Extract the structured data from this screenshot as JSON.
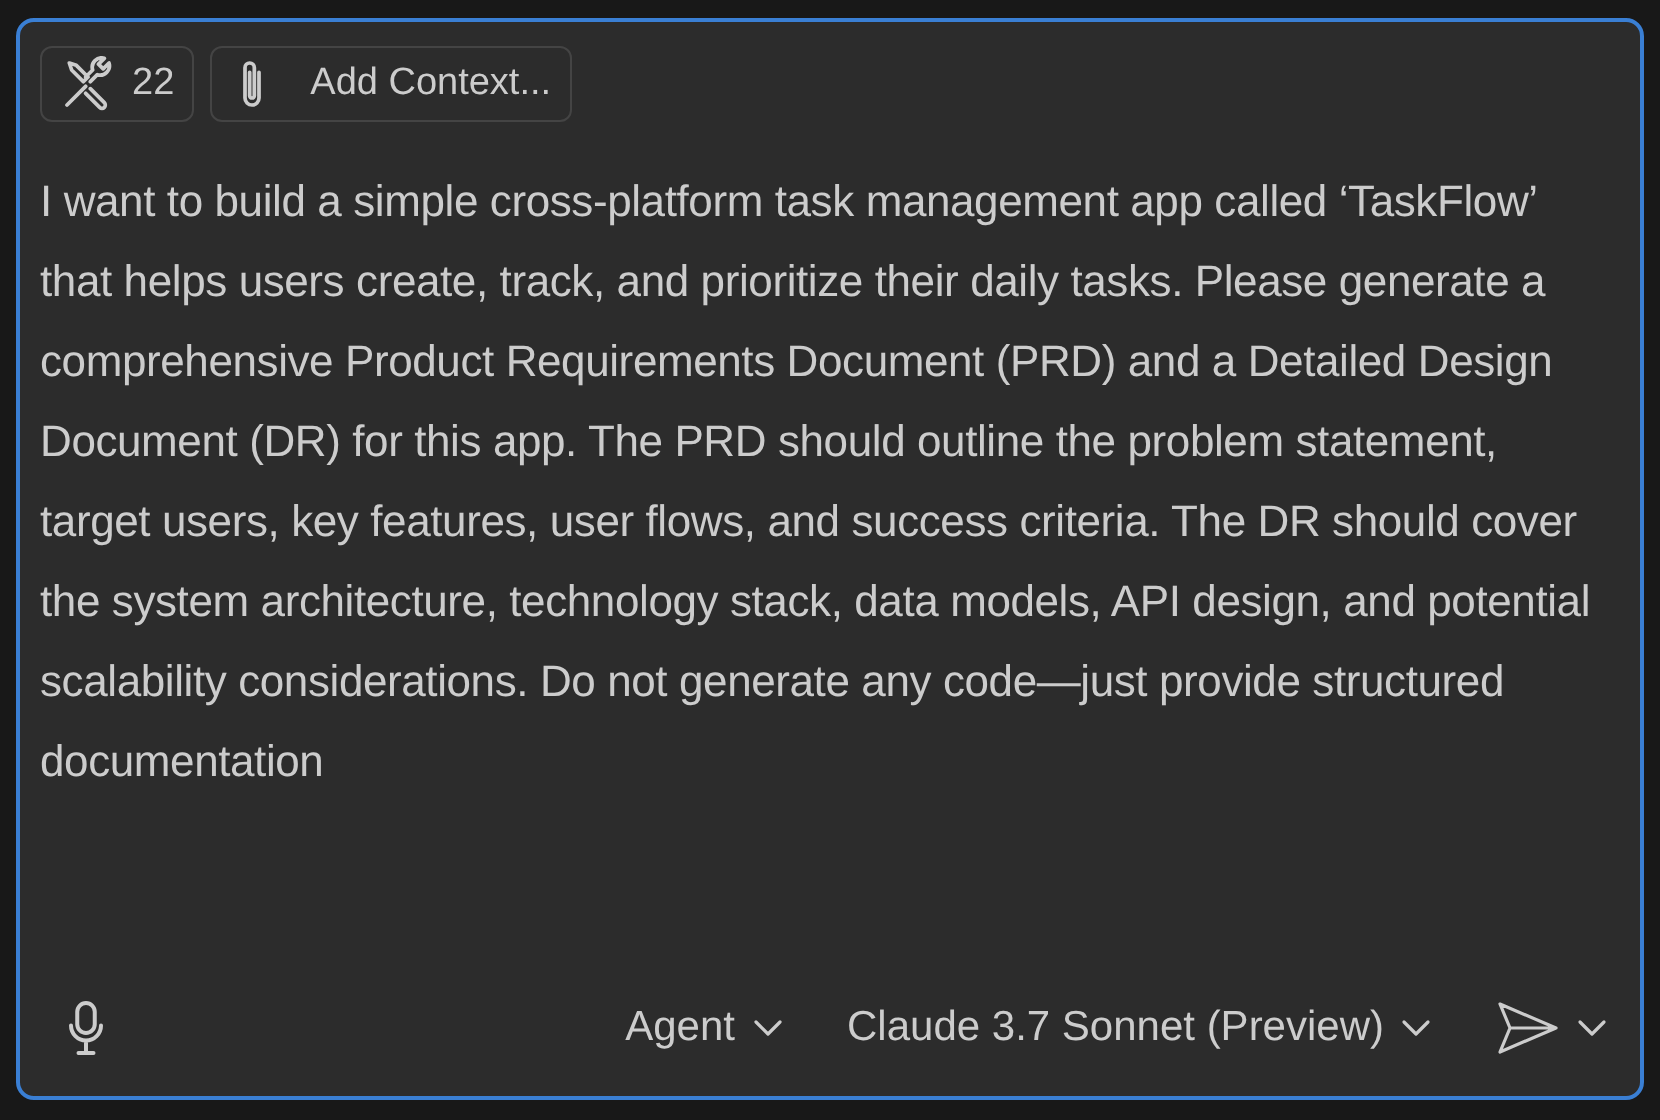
{
  "toolbar": {
    "tools_count": "22",
    "add_context": "Add Context..."
  },
  "prompt": "I want to build a simple cross-platform task management app called ‘TaskFlow’ that helps users create, track, and prioritize their daily tasks. Please generate a comprehensive Product Requirements Document (PRD) and a Detailed Design Document (DR) for this app. The PRD should outline the problem statement, target users, key features, user flows, and success criteria. The DR should cover the system architecture, technology stack, data models, API design, and potential scalability considerations. Do not generate any code—just provide structured documentation",
  "footer": {
    "mode": "Agent",
    "model": "Claude 3.7 Sonnet (Preview)"
  }
}
